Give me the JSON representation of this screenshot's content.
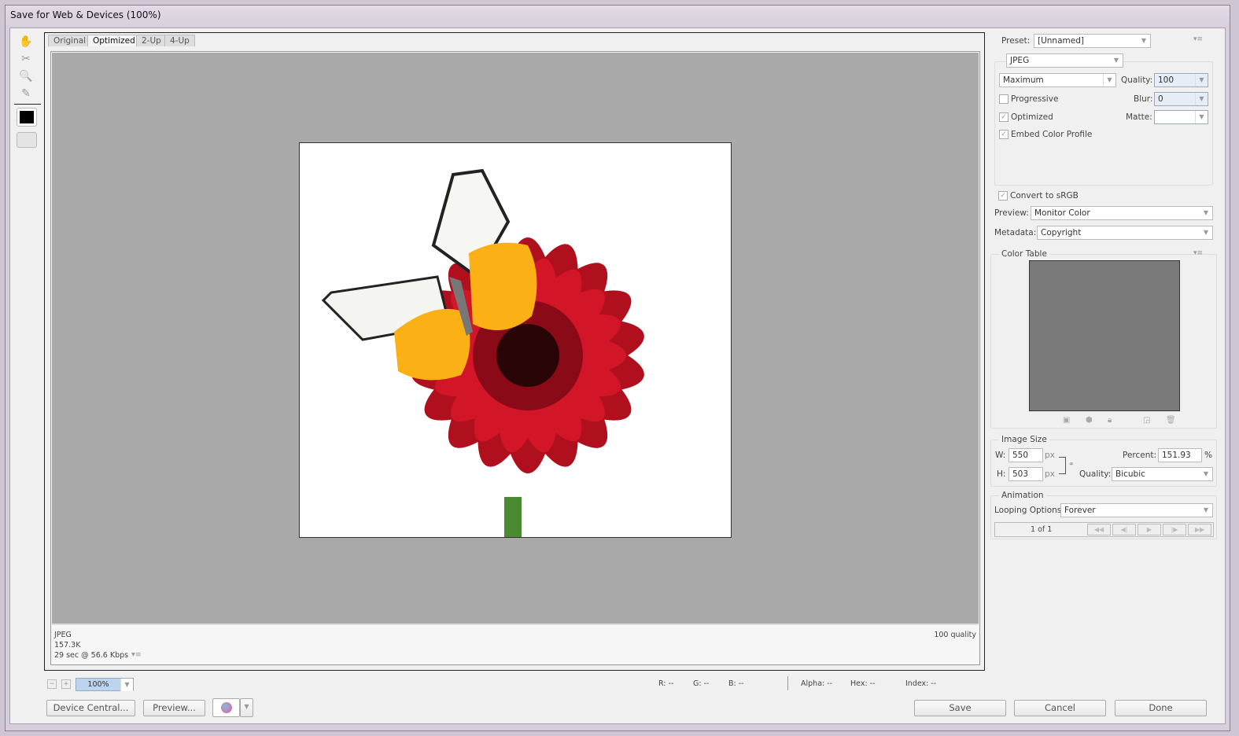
{
  "window": {
    "title": "Save for Web & Devices (100%)"
  },
  "tools": [
    {
      "name": "hand-tool",
      "glyph": "✋"
    },
    {
      "name": "slice-select-tool",
      "glyph": "✂"
    },
    {
      "name": "zoom-tool",
      "glyph": "🔍"
    },
    {
      "name": "eyedropper-tool",
      "glyph": "✎"
    }
  ],
  "eyedropper_color": "#000000",
  "tabs": [
    {
      "label": "Original"
    },
    {
      "label": "Optimized",
      "active": true
    },
    {
      "label": "2-Up"
    },
    {
      "label": "4-Up"
    }
  ],
  "canvas": {
    "background": "#a9a9a9"
  },
  "info": {
    "format": "JPEG",
    "size": "157.3K",
    "download": "29 sec @ 56.6 Kbps",
    "quality": "100 quality"
  },
  "statusbar": {
    "zoom": "100%",
    "r": "R: --",
    "g": "G: --",
    "b": "B: --",
    "alpha": "Alpha: --",
    "hex": "Hex: --",
    "index": "Index: --"
  },
  "buttons": {
    "device_central": "Device Central...",
    "preview": "Preview...",
    "save": "Save",
    "cancel": "Cancel",
    "done": "Done"
  },
  "settings": {
    "preset_label": "Preset:",
    "preset": "[Unnamed]",
    "format": "JPEG",
    "compression": "Maximum",
    "quality_label": "Quality:",
    "quality": "100",
    "blur_label": "Blur:",
    "blur": "0",
    "matte_label": "Matte:",
    "matte": "",
    "progressive": {
      "label": "Progressive",
      "checked": false
    },
    "optimized": {
      "label": "Optimized",
      "checked": true
    },
    "embed_profile": {
      "label": "Embed Color Profile",
      "checked": true
    },
    "convert_srgb": {
      "label": "Convert to sRGB",
      "checked": true
    },
    "preview_label": "Preview:",
    "preview": "Monitor Color",
    "metadata_label": "Metadata:",
    "metadata": "Copyright"
  },
  "color_table": {
    "title": "Color Table"
  },
  "image_size": {
    "title": "Image Size",
    "w_label": "W:",
    "w": "550",
    "h_label": "H:",
    "h": "503",
    "unit": "px",
    "percent_label": "Percent:",
    "percent": "151.93",
    "percent_unit": "%",
    "quality_label": "Quality:",
    "quality": "Bicubic"
  },
  "animation": {
    "title": "Animation",
    "looping_label": "Looping Options:",
    "looping": "Forever",
    "frame": "1 of 1"
  }
}
